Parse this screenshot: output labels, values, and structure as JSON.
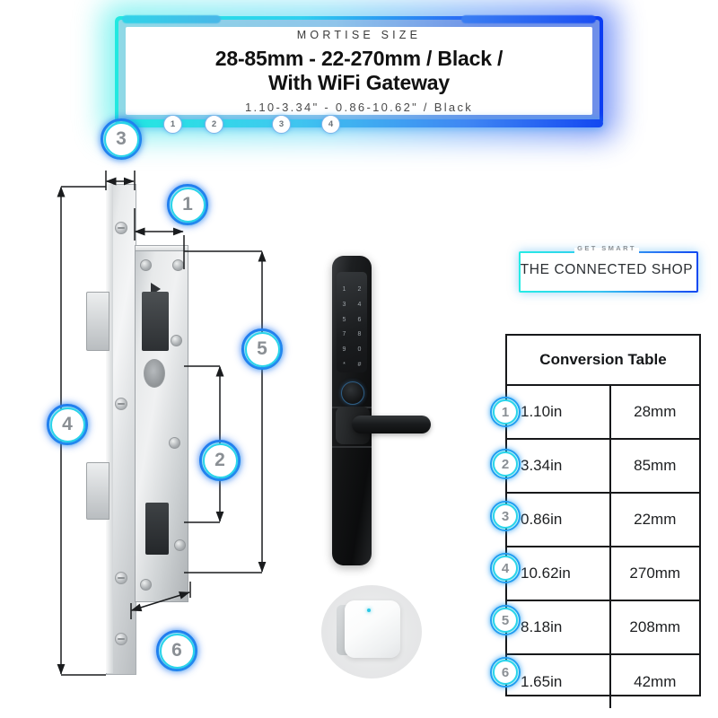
{
  "header": {
    "kicker": "MORTISE SIZE",
    "title_line1": "28-85mm - 22-270mm / Black /",
    "title_line2": "With WiFi Gateway",
    "subtitle": "1.10-3.34\" - 0.86-10.62\" / Black",
    "track_badges": [
      "1",
      "2",
      "3",
      "4"
    ],
    "colors": {
      "neon_start": "#22e8e0",
      "neon_end": "#0c3cf2",
      "badge_ring_outer": "#1f6ef0",
      "badge_ring_inner": "#2ad4ea"
    }
  },
  "diagram": {
    "callouts": [
      {
        "id": "3",
        "label": "3"
      },
      {
        "id": "1",
        "label": "1"
      },
      {
        "id": "5",
        "label": "5"
      },
      {
        "id": "4",
        "label": "4"
      },
      {
        "id": "2",
        "label": "2"
      },
      {
        "id": "6",
        "label": "6"
      }
    ],
    "keypad_keys": [
      "1",
      "2",
      "3",
      "4",
      "5",
      "6",
      "7",
      "8",
      "9",
      "0",
      "*",
      "#"
    ]
  },
  "logo": {
    "tagline": "GET SMART",
    "name": "THE CONNECTED SHOP"
  },
  "table": {
    "title": "Conversion Table",
    "rows": [
      {
        "badge": "1",
        "inches": "1.10in",
        "mm": "28mm"
      },
      {
        "badge": "2",
        "inches": "3.34in",
        "mm": "85mm"
      },
      {
        "badge": "3",
        "inches": "0.86in",
        "mm": "22mm"
      },
      {
        "badge": "4",
        "inches": "10.62in",
        "mm": "270mm"
      },
      {
        "badge": "5",
        "inches": "8.18in",
        "mm": "208mm"
      },
      {
        "badge": "6",
        "inches": "1.65in",
        "mm": "42mm"
      }
    ]
  }
}
